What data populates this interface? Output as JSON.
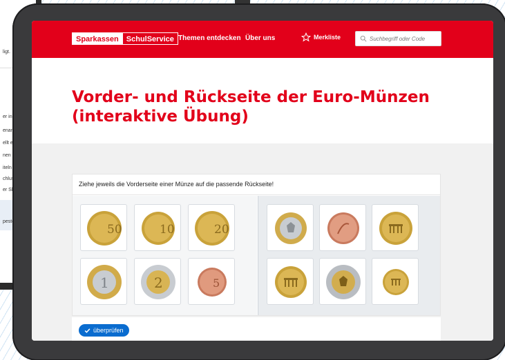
{
  "header": {
    "logo_part1": "Sparkassen",
    "logo_part2": "SchulService",
    "nav": [
      "Themen entdecken",
      "Über uns"
    ],
    "merkliste": "Merkliste",
    "search_placeholder": "Suchbegriff oder Code",
    "brand_color": "#e2001a"
  },
  "main": {
    "title": "Vorder- und Rückseite der Euro-Münzen (interaktive Übung)",
    "instruction": "Ziehe jeweils die Vorderseite einer Münze auf die passende Rückseite!",
    "check_button": "überprüfen",
    "front_coins": [
      {
        "value": "50",
        "metal": "gold",
        "icon": "coin-50-cent-common-side"
      },
      {
        "value": "10",
        "metal": "gold",
        "icon": "coin-10-cent-common-side"
      },
      {
        "value": "20",
        "metal": "gold",
        "icon": "coin-20-cent-common-side"
      },
      {
        "value": "1",
        "metal": "bimetal-gold-outer",
        "icon": "coin-1-euro-common-side"
      },
      {
        "value": "2",
        "metal": "bimetal-silver-outer",
        "icon": "coin-2-euro-common-side"
      },
      {
        "value": "5",
        "metal": "copper",
        "icon": "coin-5-cent-common-side"
      }
    ],
    "back_coins": [
      {
        "motif": "eagle",
        "metal": "bimetal-silver-center",
        "icon": "coin-back-eagle-1-euro"
      },
      {
        "motif": "oak",
        "metal": "copper",
        "icon": "coin-back-oak-twig-copper"
      },
      {
        "motif": "gate",
        "metal": "gold",
        "icon": "coin-back-brandenburg-gate-gold"
      },
      {
        "motif": "gate",
        "metal": "gold",
        "icon": "coin-back-brandenburg-gate-gold-2"
      },
      {
        "motif": "eagle",
        "metal": "bimetal-gold-center",
        "icon": "coin-back-eagle-2-euro"
      },
      {
        "motif": "gate",
        "metal": "gold",
        "icon": "coin-back-brandenburg-gate-small"
      }
    ]
  },
  "side_device": {
    "fragments": [
      "ligt.",
      "er in",
      "enann",
      "ellt e",
      "nen",
      "iteln",
      "chlus",
      "er Sl",
      "peste"
    ]
  }
}
